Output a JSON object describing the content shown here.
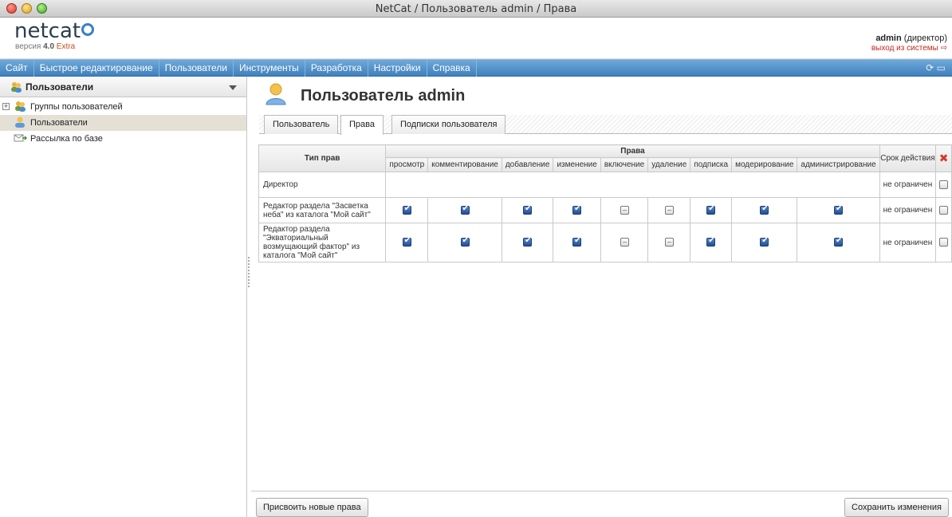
{
  "window": {
    "title": "NetCat / Пользователь admin / Права"
  },
  "header": {
    "logo_text": "netcat",
    "version_label": "версия",
    "version_number": "4.0",
    "version_edition": "Extra",
    "user_name": "admin",
    "user_role": "(директор)",
    "logout_label": "выход из системы"
  },
  "menu": {
    "items": [
      "Сайт",
      "Быстрое редактирование",
      "Пользователи",
      "Инструменты",
      "Разработка",
      "Настройки",
      "Справка"
    ]
  },
  "sidebar": {
    "title": "Пользователи",
    "items": [
      {
        "label": "Группы пользователей",
        "selected": false
      },
      {
        "label": "Пользователи",
        "selected": true
      },
      {
        "label": "Рассылка по базе",
        "selected": false
      }
    ]
  },
  "main": {
    "title": "Пользователь admin",
    "tabs": [
      {
        "label": "Пользователь",
        "active": false
      },
      {
        "label": "Права",
        "active": true
      },
      {
        "label": "Подписки пользователя",
        "active": false
      }
    ]
  },
  "rights_table": {
    "col_type": "Тип прав",
    "col_rights": "Права",
    "col_term": "Срок действия",
    "rights_columns": [
      "просмотр",
      "комментирование",
      "добавление",
      "изменение",
      "включение",
      "удаление",
      "подписка",
      "модерирование",
      "администрирование"
    ],
    "rows": [
      {
        "role": "Директор",
        "rights": null,
        "term": "не ограничен"
      },
      {
        "role": "Редактор раздела \"Засветка неба\" из каталога \"Мой сайт\"",
        "rights": [
          true,
          true,
          true,
          true,
          false,
          false,
          true,
          true,
          true
        ],
        "term": "не ограничен"
      },
      {
        "role": "Редактор раздела \"Экваториальный возмущающий фактор\" из каталога \"Мой сайт\"",
        "rights": [
          true,
          true,
          true,
          true,
          false,
          false,
          true,
          true,
          true
        ],
        "term": "не ограничен"
      }
    ]
  },
  "footer": {
    "assign_button": "Присвоить новые права",
    "save_button": "Сохранить изменения"
  }
}
